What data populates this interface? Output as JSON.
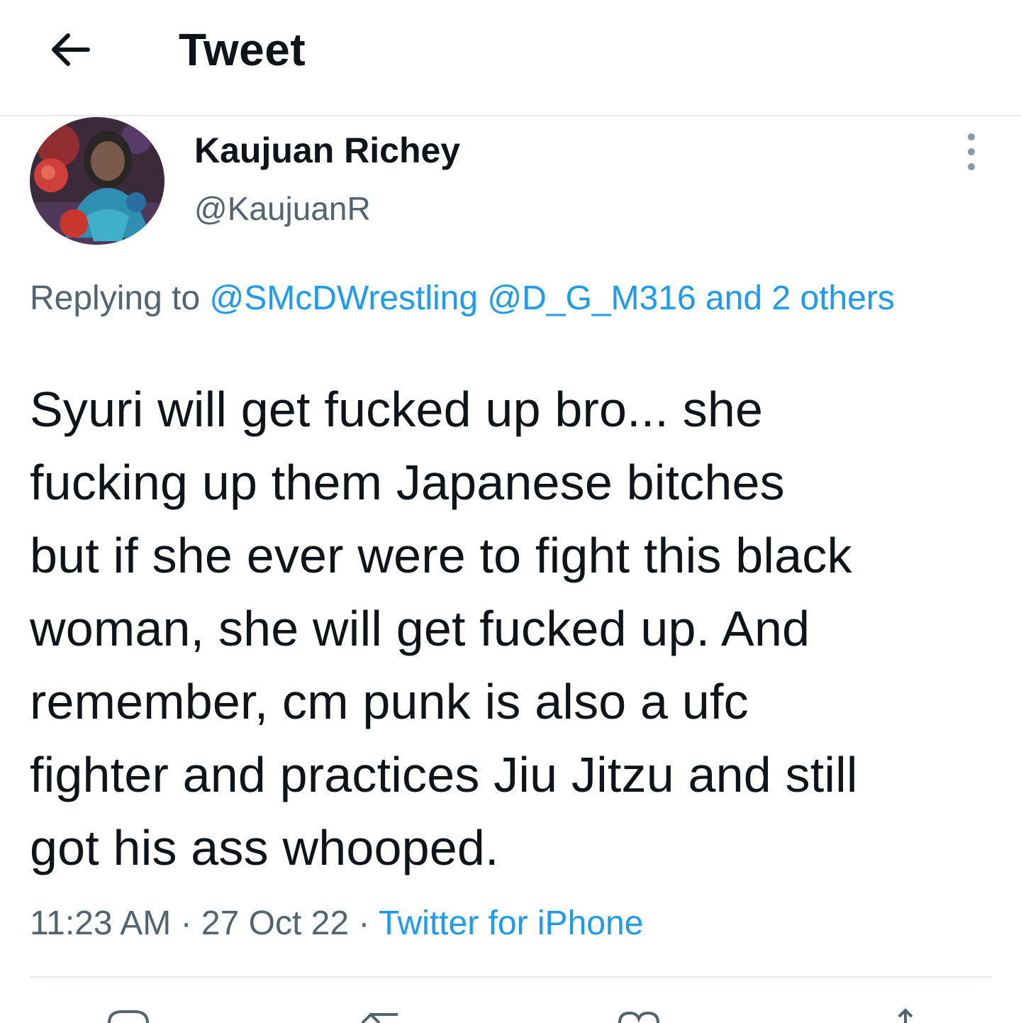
{
  "header": {
    "title": "Tweet",
    "back_icon": "arrow-left-icon"
  },
  "author": {
    "display_name": "Kaujuan Richey",
    "handle": "@KaujuanR",
    "more_icon": "more-vertical-icon"
  },
  "reply": {
    "prefix": "Replying to",
    "mentions": [
      "@SMcDWrestling",
      "@D_G_M316"
    ],
    "others": "and 2 others"
  },
  "tweet": {
    "lines": [
      "Syuri will get fucked up bro... she",
      "fucking up them Japanese bitches",
      "but if she ever were to fight this black",
      "woman, she will get fucked up. And",
      "remember, cm punk is also a ufc",
      "fighter and practices Jiu Jitzu and still",
      "got his ass whooped."
    ]
  },
  "meta": {
    "time": "11:23 AM",
    "separator": "·",
    "date": "27 Oct 22",
    "source": "Twitter for iPhone"
  },
  "actions": [
    "reply-icon",
    "retweet-icon",
    "like-icon",
    "share-icon"
  ],
  "colors": {
    "text": "#0f1419",
    "secondary": "#536471",
    "link": "#1d9bf0",
    "divider": "#e6e9ec"
  }
}
